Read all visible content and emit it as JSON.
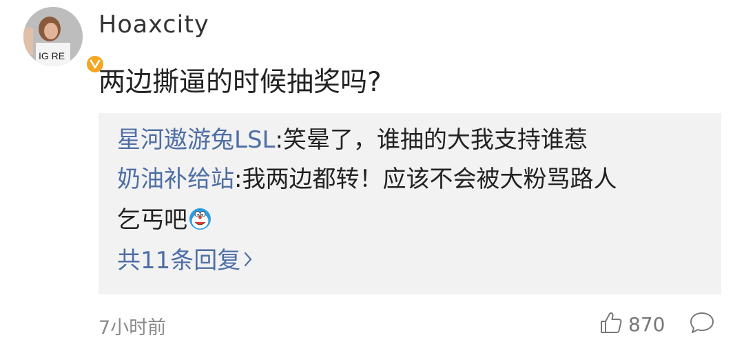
{
  "author": {
    "name": "Hoaxcity",
    "verified": true,
    "badge_color": "#f5a623"
  },
  "comment": {
    "text": "两边撕逼的时候抽奖吗?"
  },
  "replies": [
    {
      "name": "星河遨游兔LSL",
      "text": ":笑晕了，谁抽的大我支持谁惹"
    },
    {
      "name": "奶油补给站",
      "text": ":我两边都转！应该不会被大粉骂路人",
      "text2": "乞丐吧"
    }
  ],
  "more_replies": "共11条回复",
  "meta": {
    "time": "7小时前",
    "like_count": "870"
  },
  "colors": {
    "link": "#4e6ea5",
    "reply_bg": "#f2f2f2",
    "meta_text": "#8a8a8a"
  }
}
